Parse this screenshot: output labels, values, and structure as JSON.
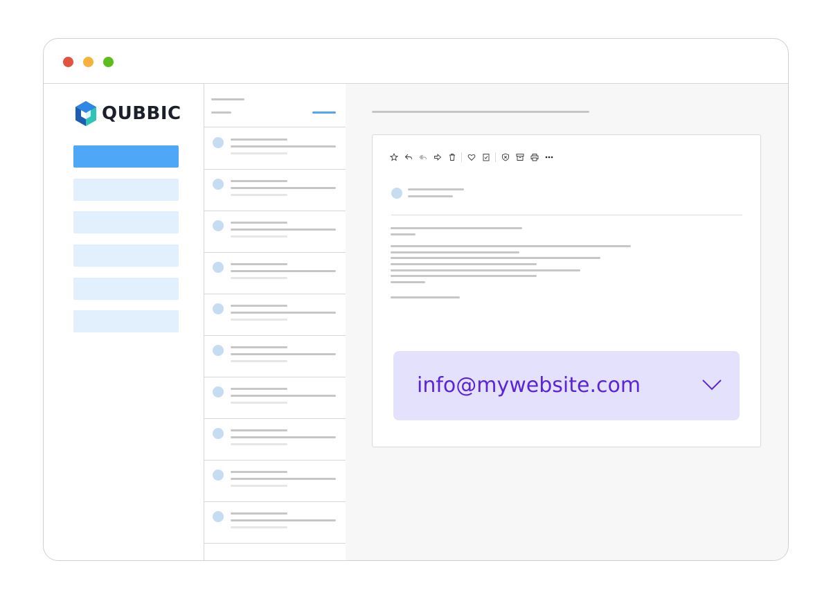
{
  "app": {
    "name": "QUBBIC"
  },
  "window_controls": {
    "close_color": "#e0533e",
    "minimize_color": "#f6b23a",
    "maximize_color": "#5cbd1e"
  },
  "colors": {
    "accent": "#4fa7f8",
    "nav_idle": "#e2effc",
    "email_bg": "#e4e1fc",
    "email_text": "#5a25d8"
  },
  "sidebar": {
    "items": [
      {
        "state": "active"
      },
      {
        "state": "idle"
      },
      {
        "state": "idle"
      },
      {
        "state": "idle"
      },
      {
        "state": "idle"
      },
      {
        "state": "idle"
      }
    ]
  },
  "toolbar": {
    "icons": [
      "star-icon",
      "reply-icon",
      "reply-all-icon",
      "forward-icon",
      "trash-icon",
      "heart-icon",
      "clipboard-check-icon",
      "shield-x-icon",
      "archive-icon",
      "print-icon",
      "more-icon"
    ]
  },
  "email_selector": {
    "value": "info@mywebsite.com",
    "icon": "chevron-down-icon"
  }
}
